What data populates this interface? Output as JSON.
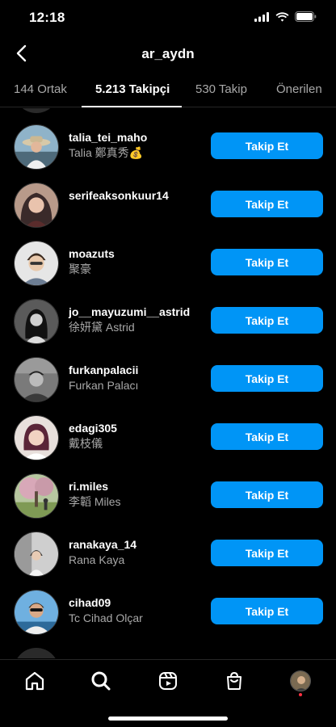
{
  "status": {
    "time": "12:18"
  },
  "header": {
    "title": "ar_aydn"
  },
  "tabs": [
    {
      "label": "144 Ortak"
    },
    {
      "label": "5.213 Takipçi",
      "active": true
    },
    {
      "label": "530 Takip"
    },
    {
      "label": "Önerilen"
    }
  ],
  "followers": [
    {
      "username": "talia_tei_maho",
      "name": "Talia 鄭真秀💰",
      "button": "Takip Et"
    },
    {
      "username": "serifeaksonkuur14",
      "name": "",
      "button": "Takip Et"
    },
    {
      "username": "moazuts",
      "name": "聚豪",
      "button": "Takip Et"
    },
    {
      "username": "jo__mayuzumi__astrid",
      "name": "徐妍黛 Astrid",
      "button": "Takip Et"
    },
    {
      "username": "furkanpalacii",
      "name": "Furkan Palacı",
      "button": "Takip Et"
    },
    {
      "username": "edagi305",
      "name": "戴枝儀",
      "button": "Takip Et"
    },
    {
      "username": "ri.miles",
      "name": "李韜 Miles",
      "button": "Takip Et"
    },
    {
      "username": "ranakaya_14",
      "name": "Rana Kaya",
      "button": "Takip Et"
    },
    {
      "username": "cihad09",
      "name": "Tc Cihad Olçar",
      "button": "Takip Et"
    }
  ],
  "bottom_nav": [
    "home-icon",
    "search-icon",
    "reels-icon",
    "shop-icon",
    "profile-avatar"
  ],
  "colors": {
    "accent": "#0095f6",
    "background": "#000000",
    "secondary_text": "#a8a8a8",
    "notification_dot": "#ff3040"
  }
}
